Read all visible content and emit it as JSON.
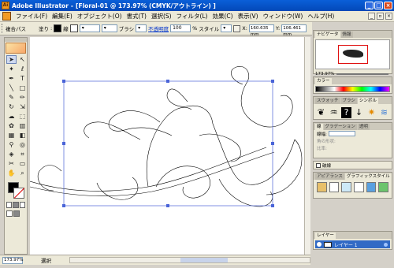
{
  "window": {
    "title": "Adobe Illustrator",
    "doc_title": "[Floral-01 @ 173.97% (CMYK/アウトライン) ]"
  },
  "menu": [
    "ファイル(F)",
    "編集(E)",
    "オブジェクト(O)",
    "書式(T)",
    "選択(S)",
    "フィルタ(L)",
    "効果(C)",
    "表示(V)",
    "ウィンドウ(W)",
    "ヘルプ(H)"
  ],
  "control": {
    "selection_label": "複合パス",
    "fill_label": "塗り",
    "stroke_label": "線",
    "brush_label": "ブラシ",
    "opacity_label": "不透明度",
    "opacity_value": "100",
    "percent": "%",
    "style_label": "スタイル",
    "x_label": "X:",
    "x_value": "160.635 mm",
    "y_label": "Y:",
    "y_value": "106.461 mm"
  },
  "status": {
    "zoom": "173.97%",
    "text": "選択"
  },
  "panels": {
    "navigator": {
      "tabs": [
        "ナビゲータ",
        "情報"
      ],
      "zoom": "173.97%"
    },
    "color": {
      "tabs": [
        "カラー"
      ]
    },
    "swatches": {
      "tabs": [
        "スウォッチ",
        "ブラシ",
        "シンボル"
      ]
    },
    "stroke": {
      "tabs": [
        "線",
        "グラデーション",
        "透明"
      ],
      "weight_label": "線幅:",
      "row2": "角の形状:",
      "row3": "比率:"
    },
    "checkbox_label": "破線",
    "appearance": {
      "tabs": [
        "アピアランス",
        "グラフィックスタイル"
      ]
    },
    "layers": {
      "tabs": [
        "レイヤー"
      ],
      "layer_name": "レイヤー 1"
    }
  },
  "colors": {
    "title_bar": "#0a5fd8",
    "selection": "#4a64d8",
    "layer_highlight": "#316ac5"
  }
}
